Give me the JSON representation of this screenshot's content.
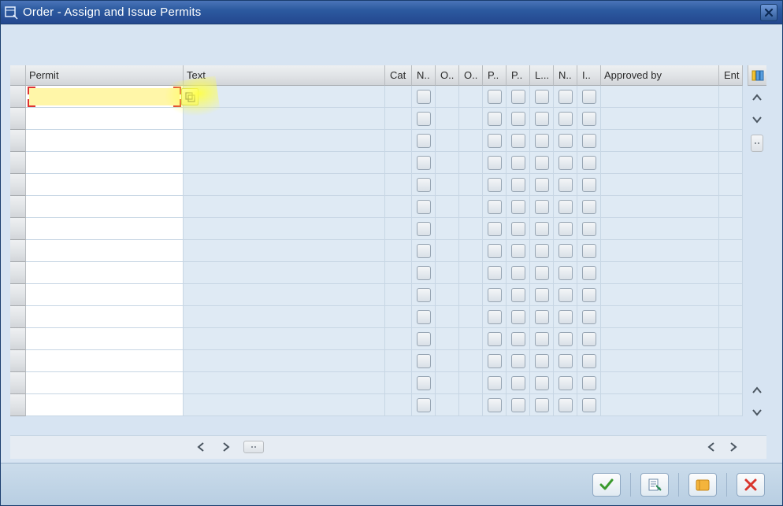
{
  "window": {
    "title": "Order - Assign and Issue Permits"
  },
  "table": {
    "columns": {
      "permit": "Permit",
      "text": "Text",
      "cat": "Cat",
      "n1": "N..",
      "o1": "O..",
      "o2": "O..",
      "p1": "P..",
      "p2": "P..",
      "l": "L...",
      "n2": "N..",
      "i": "I..",
      "approved_by": "Approved by",
      "ent": "Ent"
    },
    "rows": [
      {
        "permit": "",
        "text": "",
        "cat": "",
        "n1": false,
        "o1": "",
        "o2": "",
        "p1": false,
        "p2": false,
        "l": false,
        "n2": false,
        "i": false,
        "approved_by": "",
        "ent": ""
      },
      {
        "permit": "",
        "text": "",
        "cat": "",
        "n1": false,
        "o1": "",
        "o2": "",
        "p1": false,
        "p2": false,
        "l": false,
        "n2": false,
        "i": false,
        "approved_by": "",
        "ent": ""
      },
      {
        "permit": "",
        "text": "",
        "cat": "",
        "n1": false,
        "o1": "",
        "o2": "",
        "p1": false,
        "p2": false,
        "l": false,
        "n2": false,
        "i": false,
        "approved_by": "",
        "ent": ""
      },
      {
        "permit": "",
        "text": "",
        "cat": "",
        "n1": false,
        "o1": "",
        "o2": "",
        "p1": false,
        "p2": false,
        "l": false,
        "n2": false,
        "i": false,
        "approved_by": "",
        "ent": ""
      },
      {
        "permit": "",
        "text": "",
        "cat": "",
        "n1": false,
        "o1": "",
        "o2": "",
        "p1": false,
        "p2": false,
        "l": false,
        "n2": false,
        "i": false,
        "approved_by": "",
        "ent": ""
      },
      {
        "permit": "",
        "text": "",
        "cat": "",
        "n1": false,
        "o1": "",
        "o2": "",
        "p1": false,
        "p2": false,
        "l": false,
        "n2": false,
        "i": false,
        "approved_by": "",
        "ent": ""
      },
      {
        "permit": "",
        "text": "",
        "cat": "",
        "n1": false,
        "o1": "",
        "o2": "",
        "p1": false,
        "p2": false,
        "l": false,
        "n2": false,
        "i": false,
        "approved_by": "",
        "ent": ""
      },
      {
        "permit": "",
        "text": "",
        "cat": "",
        "n1": false,
        "o1": "",
        "o2": "",
        "p1": false,
        "p2": false,
        "l": false,
        "n2": false,
        "i": false,
        "approved_by": "",
        "ent": ""
      },
      {
        "permit": "",
        "text": "",
        "cat": "",
        "n1": false,
        "o1": "",
        "o2": "",
        "p1": false,
        "p2": false,
        "l": false,
        "n2": false,
        "i": false,
        "approved_by": "",
        "ent": ""
      },
      {
        "permit": "",
        "text": "",
        "cat": "",
        "n1": false,
        "o1": "",
        "o2": "",
        "p1": false,
        "p2": false,
        "l": false,
        "n2": false,
        "i": false,
        "approved_by": "",
        "ent": ""
      },
      {
        "permit": "",
        "text": "",
        "cat": "",
        "n1": false,
        "o1": "",
        "o2": "",
        "p1": false,
        "p2": false,
        "l": false,
        "n2": false,
        "i": false,
        "approved_by": "",
        "ent": ""
      },
      {
        "permit": "",
        "text": "",
        "cat": "",
        "n1": false,
        "o1": "",
        "o2": "",
        "p1": false,
        "p2": false,
        "l": false,
        "n2": false,
        "i": false,
        "approved_by": "",
        "ent": ""
      },
      {
        "permit": "",
        "text": "",
        "cat": "",
        "n1": false,
        "o1": "",
        "o2": "",
        "p1": false,
        "p2": false,
        "l": false,
        "n2": false,
        "i": false,
        "approved_by": "",
        "ent": ""
      },
      {
        "permit": "",
        "text": "",
        "cat": "",
        "n1": false,
        "o1": "",
        "o2": "",
        "p1": false,
        "p2": false,
        "l": false,
        "n2": false,
        "i": false,
        "approved_by": "",
        "ent": ""
      },
      {
        "permit": "",
        "text": "",
        "cat": "",
        "n1": false,
        "o1": "",
        "o2": "",
        "p1": false,
        "p2": false,
        "l": false,
        "n2": false,
        "i": false,
        "approved_by": "",
        "ent": ""
      }
    ],
    "active_row": 0
  },
  "icons": {
    "config": "column-config-icon",
    "ok": "check-icon",
    "assign": "page-icon",
    "issue": "scroll-icon",
    "cancel": "x-icon"
  }
}
